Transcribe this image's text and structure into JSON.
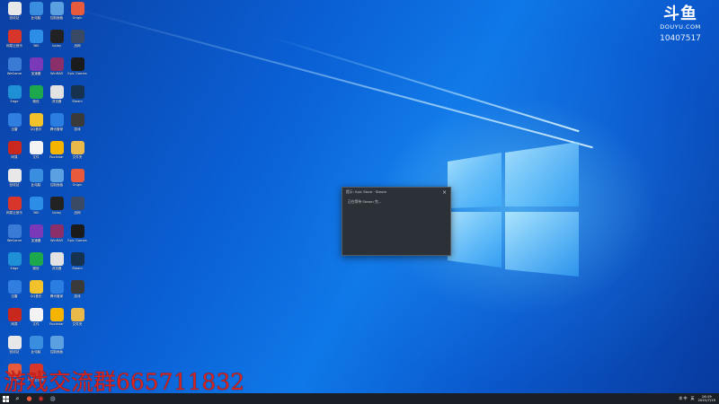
{
  "brand": {
    "name": "斗鱼",
    "sub": "DOUYU.COM",
    "room": "10407517"
  },
  "overlay_text": "游戏交流群665711832",
  "dialog": {
    "title": "提示: Epic Store · Steam",
    "message": "正在等待 Steam 完...",
    "close": "×"
  },
  "desktop_icons": [
    {
      "label": "回收站",
      "color": "#e8e8e8"
    },
    {
      "label": "此电脑",
      "color": "#3a8ee0"
    },
    {
      "label": "控制面板",
      "color": "#5ba0e0"
    },
    {
      "label": "Origin",
      "color": "#e85a3c"
    },
    {
      "label": "网易云音乐",
      "color": "#d8362b"
    },
    {
      "label": "360",
      "color": "#2d8ee8"
    },
    {
      "label": "Uplay",
      "color": "#222"
    },
    {
      "label": "战网",
      "color": "#3b4a64"
    },
    {
      "label": "WeGame",
      "color": "#3a7bd5"
    },
    {
      "label": "加速器",
      "color": "#7a3ab8"
    },
    {
      "label": "WinRAR",
      "color": "#8b2f6b"
    },
    {
      "label": "Epic Games",
      "color": "#1b1b1b"
    },
    {
      "label": "Edge",
      "color": "#1f8fd6"
    },
    {
      "label": "微信",
      "color": "#1da84d"
    },
    {
      "label": "浏览器",
      "color": "#e2e2e2"
    },
    {
      "label": "Steam",
      "color": "#17324f"
    },
    {
      "label": "迅雷",
      "color": "#2f7ee0"
    },
    {
      "label": "QQ音乐",
      "color": "#f2c22b"
    },
    {
      "label": "腾讯管家",
      "color": "#2a7de1"
    },
    {
      "label": "游戏",
      "color": "#3a3a3a"
    },
    {
      "label": "网易",
      "color": "#c8281e"
    },
    {
      "label": "文件",
      "color": "#f3f3f3"
    },
    {
      "label": "Rockstar",
      "color": "#f4b400"
    },
    {
      "label": "文件夹",
      "color": "#e9b949"
    }
  ],
  "taskbar": {
    "start_icon": "windows-logo-icon",
    "time": "16:19",
    "date": "2022/7/19",
    "ime": "英",
    "tray_label": "㊟ 中"
  }
}
